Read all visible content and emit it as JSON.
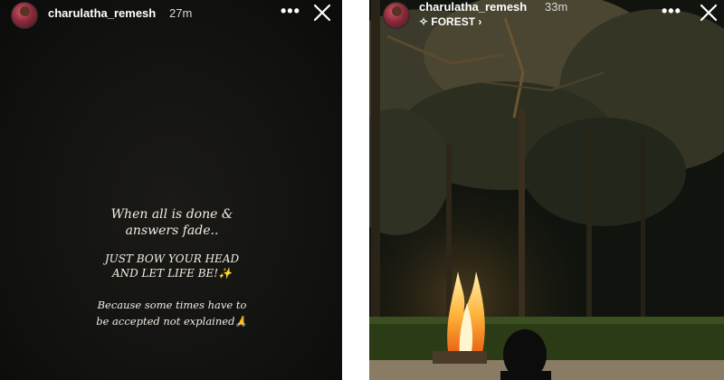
{
  "left_story": {
    "username": "charulatha_remesh",
    "time": "27m",
    "more_label": "•••",
    "quote_line1": "When all is done &",
    "quote_line2": "answers fade..",
    "quote_line3": "JUST BOW YOUR HEAD",
    "quote_line4": "AND LET LIFE BE!✨",
    "quote_line5": "Because some times have to",
    "quote_line6": "be accepted not explained🙏"
  },
  "right_story": {
    "username": "charulatha_remesh",
    "time": "33m",
    "location": "✧ FOREST ›",
    "more_label": "•••"
  },
  "colors": {
    "left_background": "#121210",
    "text": "#ffffff",
    "quote_text": "#f1ede4"
  }
}
